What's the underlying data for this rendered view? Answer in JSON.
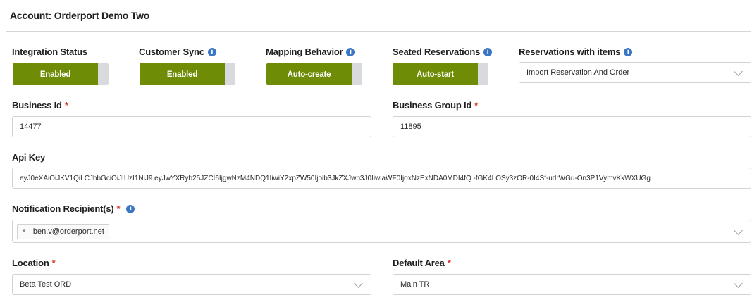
{
  "account_title": "Account: Orderport Demo Two",
  "toggles": {
    "integration_status": {
      "label": "Integration Status",
      "value": "Enabled"
    },
    "customer_sync": {
      "label": "Customer Sync",
      "value": "Enabled"
    },
    "mapping_behavior": {
      "label": "Mapping Behavior",
      "value": "Auto-create"
    },
    "seated_reservations": {
      "label": "Seated Reservations",
      "value": "Auto-start"
    }
  },
  "reservations_with_items": {
    "label": "Reservations with items",
    "value": "Import Reservation And Order"
  },
  "business_id": {
    "label": "Business Id",
    "value": "14477"
  },
  "business_group_id": {
    "label": "Business Group Id",
    "value": "11895"
  },
  "api_key": {
    "label": "Api Key",
    "value": "eyJ0eXAiOiJKV1QiLCJhbGciOiJIUzI1NiJ9.eyJwYXRyb25JZCI6IjgwNzM4NDQ1IiwiY2xpZW50Ijoib3JkZXJwb3J0IiwiaWF0IjoxNzExNDA0MDI4fQ.-fGK4LOSy3zOR-0I4Sf-udrWGu-On3P1VymvKkWXUGg"
  },
  "notification_recipients": {
    "label": "Notification Recipient(s)",
    "tags": [
      "ben.v@orderport.net"
    ],
    "remove_symbol": "×"
  },
  "location": {
    "label": "Location",
    "value": "Beta Test ORD"
  },
  "default_area": {
    "label": "Default Area",
    "value": "Main TR"
  },
  "required_marker": "*",
  "info_symbol": "i",
  "colors": {
    "toggle_on": "#6e8c06",
    "info": "#3b76c2",
    "required": "#d9342b"
  }
}
